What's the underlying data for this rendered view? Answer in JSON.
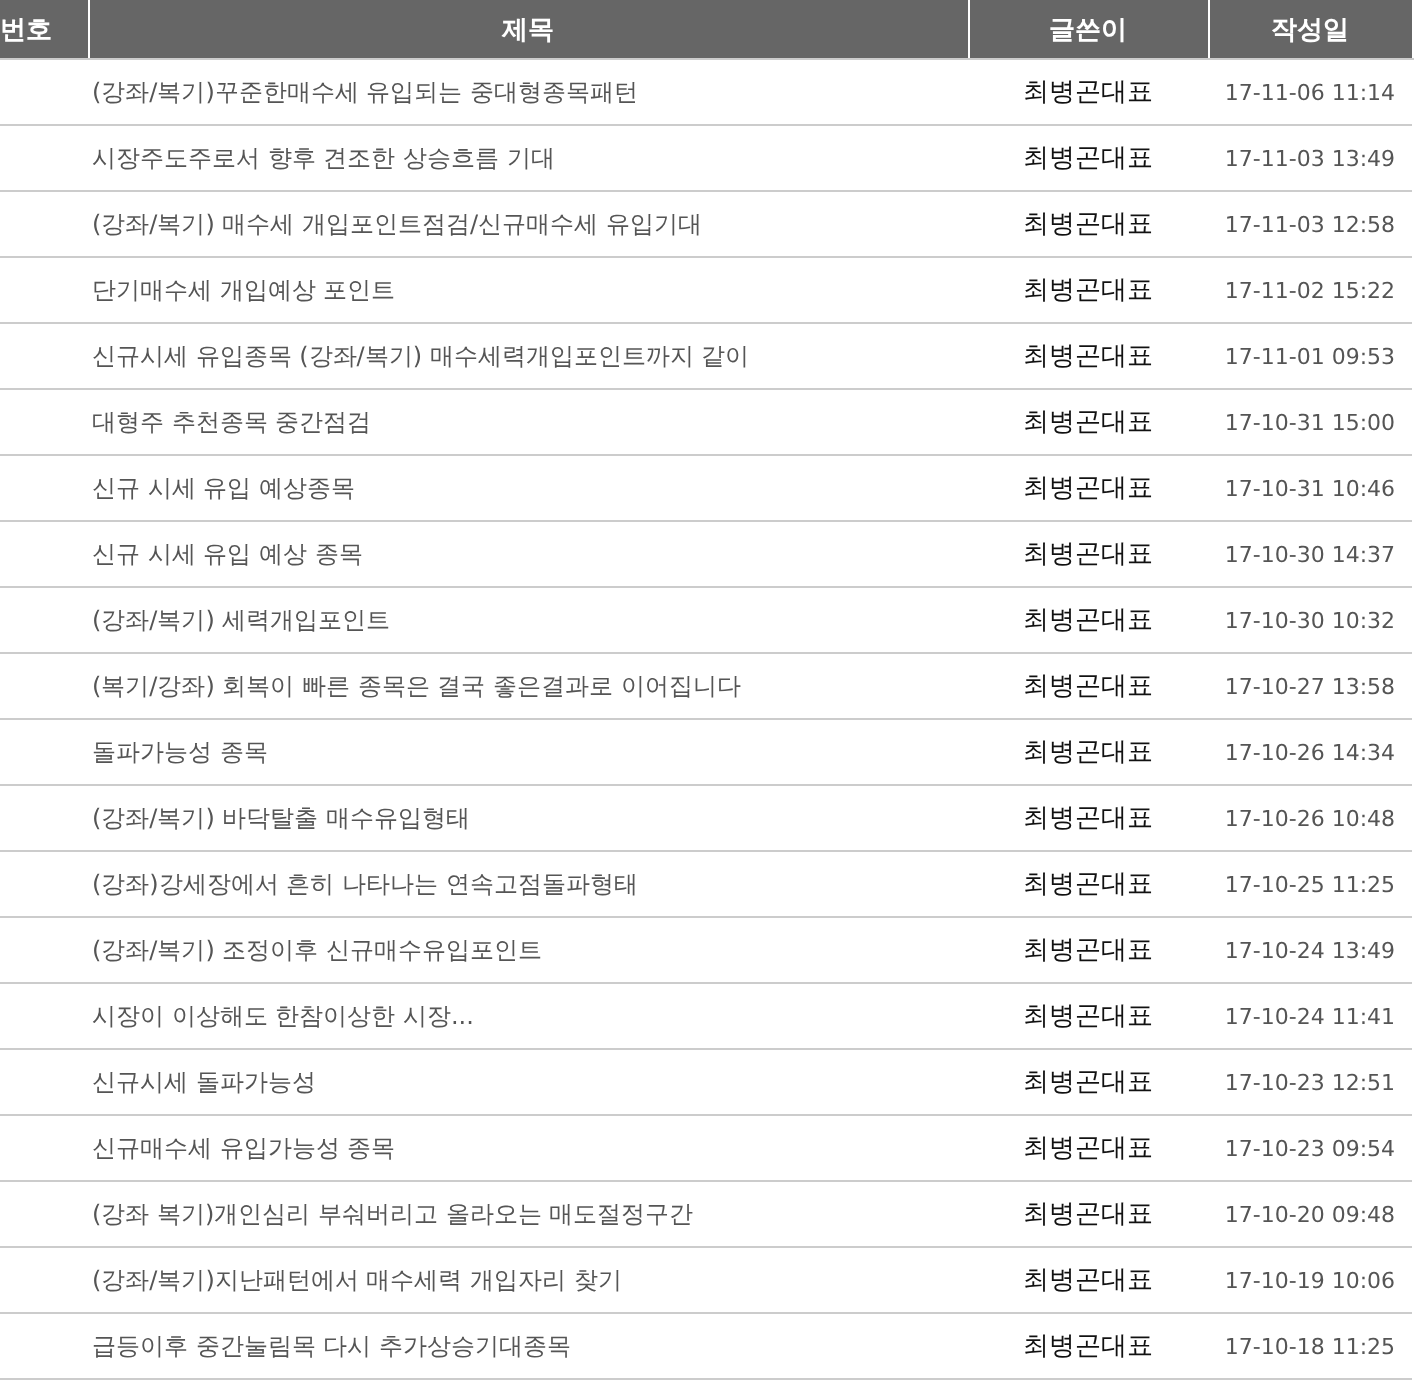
{
  "table": {
    "columns": [
      "번호",
      "제목",
      "글쓴이",
      "작성일"
    ],
    "rows": [
      {
        "title": "(강좌/복기)꾸준한매수세 유입되는 중대형종목패턴",
        "author": "최병곤대표",
        "date": "17-11-06 11:14"
      },
      {
        "title": "시장주도주로서 향후 견조한 상승흐름 기대",
        "author": "최병곤대표",
        "date": "17-11-03 13:49"
      },
      {
        "title": "(강좌/복기) 매수세 개입포인트점검/신규매수세 유입기대",
        "author": "최병곤대표",
        "date": "17-11-03 12:58"
      },
      {
        "title": "단기매수세 개입예상 포인트",
        "author": "최병곤대표",
        "date": "17-11-02 15:22"
      },
      {
        "title": "신규시세 유입종목 (강좌/복기) 매수세력개입포인트까지 같이",
        "author": "최병곤대표",
        "date": "17-11-01 09:53"
      },
      {
        "title": "대형주 추천종목 중간점검",
        "author": "최병곤대표",
        "date": "17-10-31 15:00"
      },
      {
        "title": "신규 시세 유입 예상종목",
        "author": "최병곤대표",
        "date": "17-10-31 10:46"
      },
      {
        "title": "신규 시세 유입 예상 종목",
        "author": "최병곤대표",
        "date": "17-10-30 14:37"
      },
      {
        "title": "(강좌/복기) 세력개입포인트",
        "author": "최병곤대표",
        "date": "17-10-30 10:32"
      },
      {
        "title": "(복기/강좌) 회복이 빠른 종목은 결국 좋은결과로 이어집니다",
        "author": "최병곤대표",
        "date": "17-10-27 13:58"
      },
      {
        "title": "돌파가능성 종목",
        "author": "최병곤대표",
        "date": "17-10-26 14:34"
      },
      {
        "title": "(강좌/복기) 바닥탈출 매수유입형태",
        "author": "최병곤대표",
        "date": "17-10-26 10:48"
      },
      {
        "title": "(강좌)강세장에서 흔히 나타나는 연속고점돌파형태",
        "author": "최병곤대표",
        "date": "17-10-25 11:25"
      },
      {
        "title": "(강좌/복기) 조정이후 신규매수유입포인트",
        "author": "최병곤대표",
        "date": "17-10-24 13:49"
      },
      {
        "title": "시장이 이상해도 한참이상한 시장...",
        "author": "최병곤대표",
        "date": "17-10-24 11:41"
      },
      {
        "title": "신규시세 돌파가능성",
        "author": "최병곤대표",
        "date": "17-10-23 12:51"
      },
      {
        "title": "신규매수세 유입가능성 종목",
        "author": "최병곤대표",
        "date": "17-10-23 09:54"
      },
      {
        "title": "(강좌 복기)개인심리 부숴버리고 올라오는 매도절정구간",
        "author": "최병곤대표",
        "date": "17-10-20 09:48"
      },
      {
        "title": "(강좌/복기)지난패턴에서 매수세력 개입자리 찾기",
        "author": "최병곤대표",
        "date": "17-10-19 10:06"
      },
      {
        "title": "급등이후 중간눌림목 다시 추가상승기대종목",
        "author": "최병곤대표",
        "date": "17-10-18 11:25"
      }
    ]
  }
}
